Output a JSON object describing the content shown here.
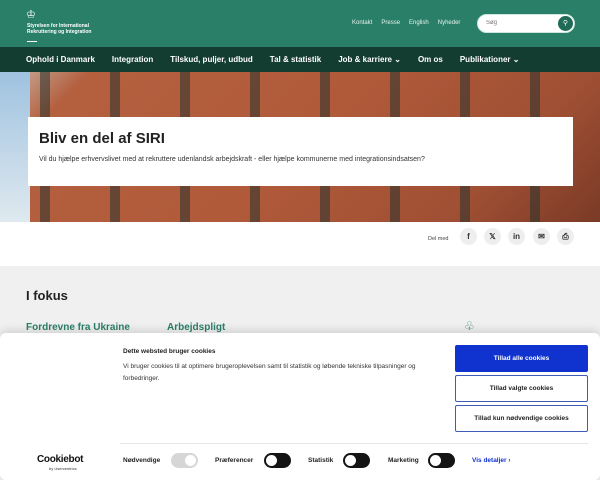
{
  "header": {
    "logo_text_1": "Styrelsen for International",
    "logo_text_2": "Rekruttering og Integration",
    "links": [
      "Kontakt",
      "Presse",
      "English",
      "Nyheder"
    ],
    "search_placeholder": "Søg"
  },
  "nav": [
    "Ophold i Danmark",
    "Integration",
    "Tilskud, puljer, udbud",
    "Tal & statistik",
    "Job & karriere ⌄",
    "Om os",
    "Publikationer ⌄"
  ],
  "hero": {
    "title": "Bliv en del af SIRI",
    "text": "Vil du hjælpe erhvervslivet med at rekruttere udenlandsk arbejdskraft - eller hjælpe kommunerne med integrationsindsatsen?"
  },
  "share": {
    "label": "Del med",
    "icons": [
      "facebook-icon",
      "x-icon",
      "linkedin-icon",
      "mail-icon",
      "print-icon"
    ]
  },
  "focus": {
    "title": "I fokus",
    "cards": [
      "Fordrevne fra Ukraine",
      "Arbejdspligt"
    ]
  },
  "cookie": {
    "title": "Dette websted bruger cookies",
    "text": "Vi bruger cookies til at optimere brugeroplevelsen samt til statistik og løbende tekniske tilpasninger og forbedringer.",
    "allow_all": "Tillad alle cookies",
    "allow_selected": "Tillad valgte cookies",
    "allow_necessary": "Tillad kun nødvendige cookies",
    "logo": "Cookiebot",
    "logo_sub": "by Usercentrics",
    "toggles": [
      {
        "label": "Nødvendige",
        "on": true
      },
      {
        "label": "Præferencer",
        "on": false
      },
      {
        "label": "Statistik",
        "on": false
      },
      {
        "label": "Marketing",
        "on": false
      }
    ],
    "details": "Vis detaljer  ›"
  },
  "colors": {
    "header": "#2a7f68",
    "nav": "#143d31",
    "primary_button": "#1032cf"
  }
}
